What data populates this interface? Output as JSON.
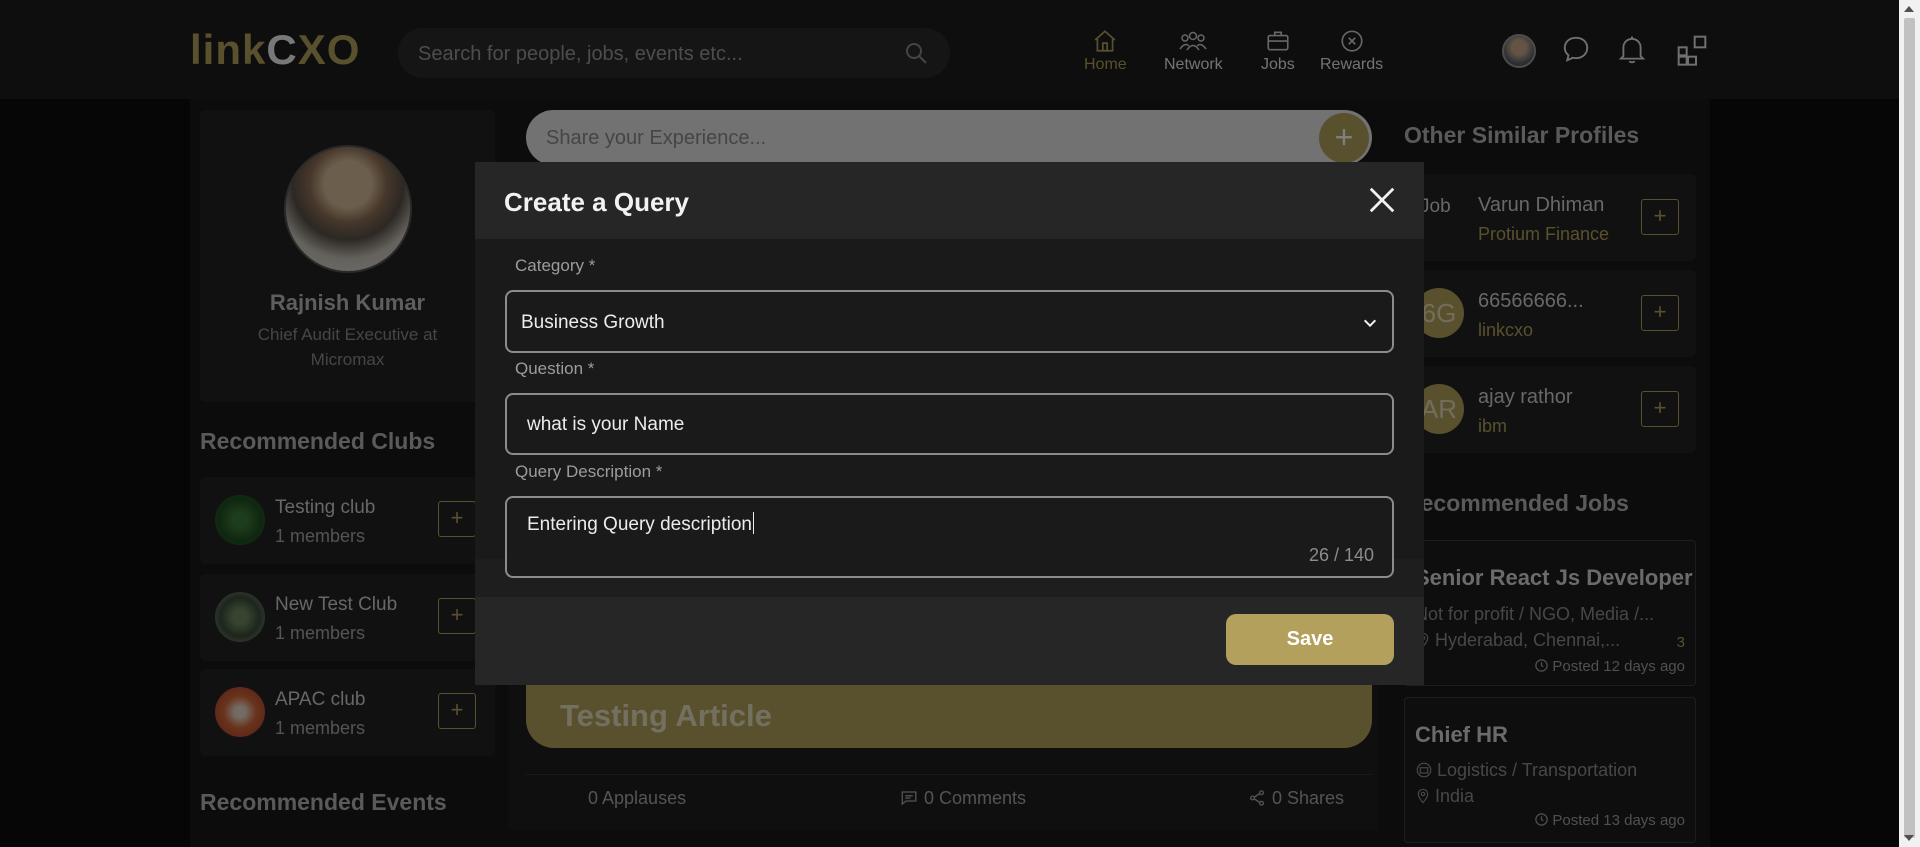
{
  "header": {
    "logo_text": "linkCXO",
    "search_placeholder": "Search for people, jobs, events etc...",
    "nav": [
      {
        "label": "Home",
        "icon": "home-icon",
        "active": true
      },
      {
        "label": "Network",
        "icon": "network-icon",
        "active": false
      },
      {
        "label": "Jobs",
        "icon": "briefcase-icon",
        "active": false
      },
      {
        "label": "Rewards",
        "icon": "rewards-icon",
        "active": false
      }
    ],
    "right_icons": [
      "avatar",
      "chat-icon",
      "bell-icon",
      "apps-grid-icon"
    ]
  },
  "profile": {
    "name": "Rajnish Kumar",
    "title": "Chief Audit Executive at Micromax"
  },
  "recommended_clubs": {
    "title": "Recommended Clubs",
    "items": [
      {
        "name": "Testing club",
        "members": "1 members"
      },
      {
        "name": "New Test Club",
        "members": "1 members"
      },
      {
        "name": "APAC club",
        "members": "1 members"
      }
    ],
    "add_label": "+"
  },
  "recommended_events": {
    "title": "Recommended Events"
  },
  "feed": {
    "share_placeholder": "Share your Experience...",
    "share_add_label": "+",
    "article_title": "Testing Article",
    "applauses": "0 Applauses",
    "comments": "0 Comments",
    "shares": "0 Shares"
  },
  "similar_profiles": {
    "title": "Other Similar Profiles",
    "items": [
      {
        "name": "Varun Dhiman",
        "org": "Protium Finance",
        "avatar_text": "Job"
      },
      {
        "name": "66566666...",
        "org": "linkcxo",
        "avatar_text": "6G"
      },
      {
        "name": "ajay rathor",
        "org": "ibm",
        "avatar_text": "AR"
      }
    ],
    "add_label": "+"
  },
  "recommended_jobs": {
    "title": "Recommended Jobs",
    "items": [
      {
        "title": "Senior React Js Developer",
        "industry": "Not for profit / NGO, Media /...",
        "location": "Hyderabad, Chennai,...",
        "extra": "3",
        "posted": "Posted 12 days ago"
      },
      {
        "title": "Chief HR",
        "industry": "Logistics / Transportation",
        "location": "India",
        "posted": "Posted 13 days ago"
      }
    ]
  },
  "modal": {
    "title": "Create a Query",
    "category_label": "Category *",
    "category_value": "Business Growth",
    "question_label": "Question *",
    "question_value": "what is your Name",
    "description_label": "Query Description *",
    "description_value": "Entering Query description",
    "description_counter": "26 / 140",
    "save_label": "Save"
  },
  "colors": {
    "accent": "#b3a05d",
    "background": "#0c0c0c",
    "card": "#222222"
  }
}
